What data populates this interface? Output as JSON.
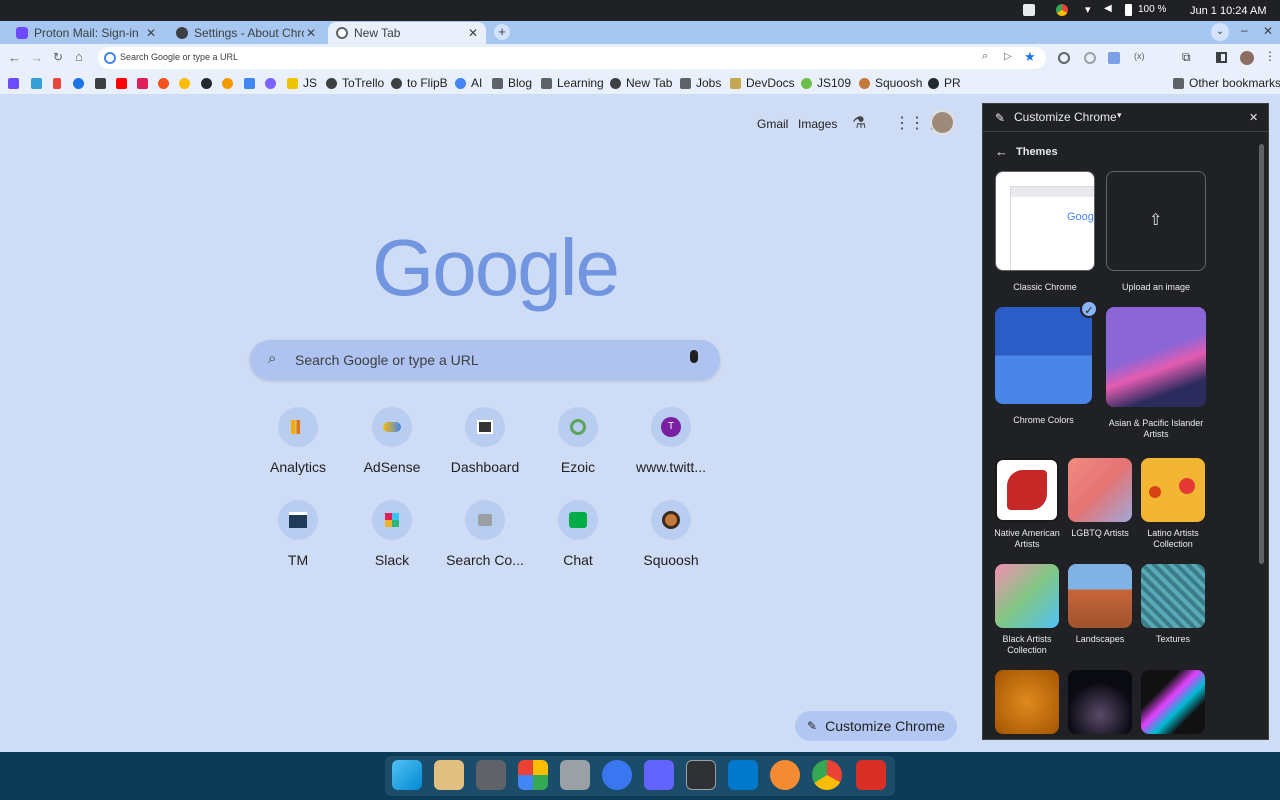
{
  "system": {
    "date": "Jun 1",
    "time": "10:24 AM",
    "battery": "100 %"
  },
  "tabs": [
    {
      "title": "Proton Mail: Sign-in",
      "color": "#6d4aff"
    },
    {
      "title": "Settings - About Chrom",
      "color": "#3c4043"
    },
    {
      "title": "New Tab",
      "color": "#5f6368"
    }
  ],
  "omnibox": {
    "placeholder": "Search Google or type a URL"
  },
  "bookmarks": [
    {
      "label": "JS"
    },
    {
      "label": "ToTrello"
    },
    {
      "label": "to FlipB"
    },
    {
      "label": "AI"
    },
    {
      "label": "Blog"
    },
    {
      "label": "Learning"
    },
    {
      "label": "New Tab"
    },
    {
      "label": "Jobs"
    },
    {
      "label": "DevDocs"
    },
    {
      "label": "JS109"
    },
    {
      "label": "Squoosh"
    },
    {
      "label": "PR"
    }
  ],
  "other_bookmarks": "Other bookmarks",
  "ntp": {
    "gmail": "Gmail",
    "images": "Images",
    "logo": "Google",
    "search_placeholder": "Search Google or type a URL",
    "shortcuts": [
      {
        "label": "Analytics"
      },
      {
        "label": "AdSense"
      },
      {
        "label": "Dashboard"
      },
      {
        "label": "Ezoic"
      },
      {
        "label": "www.twitt..."
      },
      {
        "label": "TM"
      },
      {
        "label": "Slack"
      },
      {
        "label": "Search Co..."
      },
      {
        "label": "Chat"
      },
      {
        "label": "Squoosh"
      }
    ],
    "customize_button": "Customize Chrome"
  },
  "panel": {
    "title": "Customize Chrome",
    "section": "Themes",
    "themes": {
      "classic": "Classic Chrome",
      "upload": "Upload an image",
      "chrome_colors": "Chrome Colors",
      "asian": "Asian & Pacific Islander Artists",
      "native": "Native American Artists",
      "lgbtq": "LGBTQ Artists",
      "latino": "Latino Artists Collection",
      "black": "Black Artists Collection",
      "landscapes": "Landscapes",
      "textures": "Textures"
    },
    "classic_preview_text": "Goog"
  }
}
